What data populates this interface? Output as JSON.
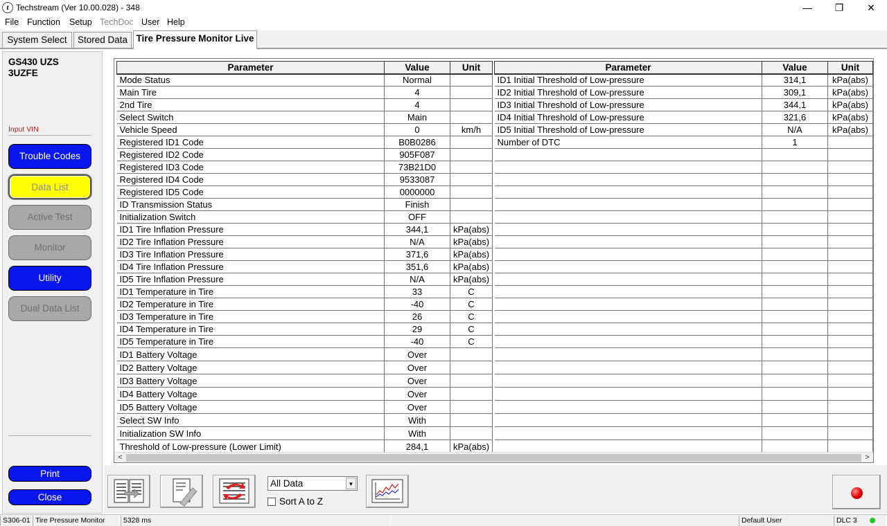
{
  "window": {
    "title": "Techstream (Ver 10.00.028) - 348",
    "minimize": "—",
    "maximize": "❐",
    "close": "✕"
  },
  "menu": [
    "File",
    "Function",
    "Setup",
    "TechDoc",
    "User",
    "Help"
  ],
  "tabs": [
    "System Select",
    "Stored Data",
    "Tire Pressure Monitor Live"
  ],
  "vehicle": {
    "model": "GS430 UZS",
    "engine": "3UZFE",
    "input_vin": "Input VIN"
  },
  "sidebar": {
    "buttons": [
      "Trouble Codes",
      "Data List",
      "Active Test",
      "Monitor",
      "Utility",
      "Dual Data List"
    ],
    "print": "Print",
    "close": "Close"
  },
  "grid": {
    "headers": [
      "Parameter",
      "Value",
      "Unit"
    ],
    "left_rows": [
      [
        "Mode Status",
        "Normal",
        ""
      ],
      [
        "Main Tire",
        "4",
        ""
      ],
      [
        "2nd Tire",
        "4",
        ""
      ],
      [
        "Select Switch",
        "Main",
        ""
      ],
      [
        "Vehicle Speed",
        "0",
        "km/h"
      ],
      [
        "Registered ID1 Code",
        "B0B0286",
        ""
      ],
      [
        "Registered ID2 Code",
        "905F087",
        ""
      ],
      [
        "Registered ID3 Code",
        "73B21D0",
        ""
      ],
      [
        "Registered ID4 Code",
        "9533087",
        ""
      ],
      [
        "Registered ID5 Code",
        "0000000",
        ""
      ],
      [
        "ID Transmission Status",
        "Finish",
        ""
      ],
      [
        "Initialization Switch",
        "OFF",
        ""
      ],
      [
        "ID1 Tire Inflation Pressure",
        "344,1",
        "kPa(abs)"
      ],
      [
        "ID2 Tire Inflation Pressure",
        "N/A",
        "kPa(abs)"
      ],
      [
        "ID3 Tire Inflation Pressure",
        "371,6",
        "kPa(abs)"
      ],
      [
        "ID4 Tire Inflation Pressure",
        "351,6",
        "kPa(abs)"
      ],
      [
        "ID5 Tire Inflation Pressure",
        "N/A",
        "kPa(abs)"
      ],
      [
        "ID1 Temperature in Tire",
        "33",
        "C"
      ],
      [
        "ID2 Temperature in Tire",
        "-40",
        "C"
      ],
      [
        "ID3 Temperature in Tire",
        "26",
        "C"
      ],
      [
        "ID4 Temperature in Tire",
        "29",
        "C"
      ],
      [
        "ID5 Temperature in Tire",
        "-40",
        "C"
      ],
      [
        "ID1 Battery Voltage",
        "Over",
        ""
      ],
      [
        "ID2 Battery Voltage",
        "Over",
        ""
      ],
      [
        "ID3 Battery Voltage",
        "Over",
        ""
      ],
      [
        "ID4 Battery Voltage",
        "Over",
        ""
      ],
      [
        "ID5 Battery Voltage",
        "Over",
        ""
      ],
      [
        "Select SW Info",
        "With",
        ""
      ],
      [
        "Initialization SW Info",
        "With",
        ""
      ],
      [
        "Threshold of Low-pressure (Lower Limit)",
        "284,1",
        "kPa(abs)"
      ]
    ],
    "right_rows": [
      [
        "ID1 Initial Threshold of Low-pressure",
        "314,1",
        "kPa(abs)"
      ],
      [
        "ID2 Initial Threshold of Low-pressure",
        "309,1",
        "kPa(abs)"
      ],
      [
        "ID3 Initial Threshold of Low-pressure",
        "344,1",
        "kPa(abs)"
      ],
      [
        "ID4 Initial Threshold of Low-pressure",
        "321,6",
        "kPa(abs)"
      ],
      [
        "ID5 Initial Threshold of Low-pressure",
        "N/A",
        "kPa(abs)"
      ],
      [
        "Number of DTC",
        "1",
        ""
      ]
    ]
  },
  "toolbar": {
    "filter_value": "All Data",
    "sort_label": "Sort A to Z"
  },
  "status": {
    "code": "S306-01",
    "system": "Tire Pressure Monitor",
    "time": "5328 ms",
    "user": "Default User",
    "connection": "DLC 3",
    "led_color": "#22cc22"
  },
  "colors": {
    "button_blue": "#0a16ee",
    "selected_yellow": "#ffff00",
    "disabled_gray": "#a8a8a8"
  }
}
